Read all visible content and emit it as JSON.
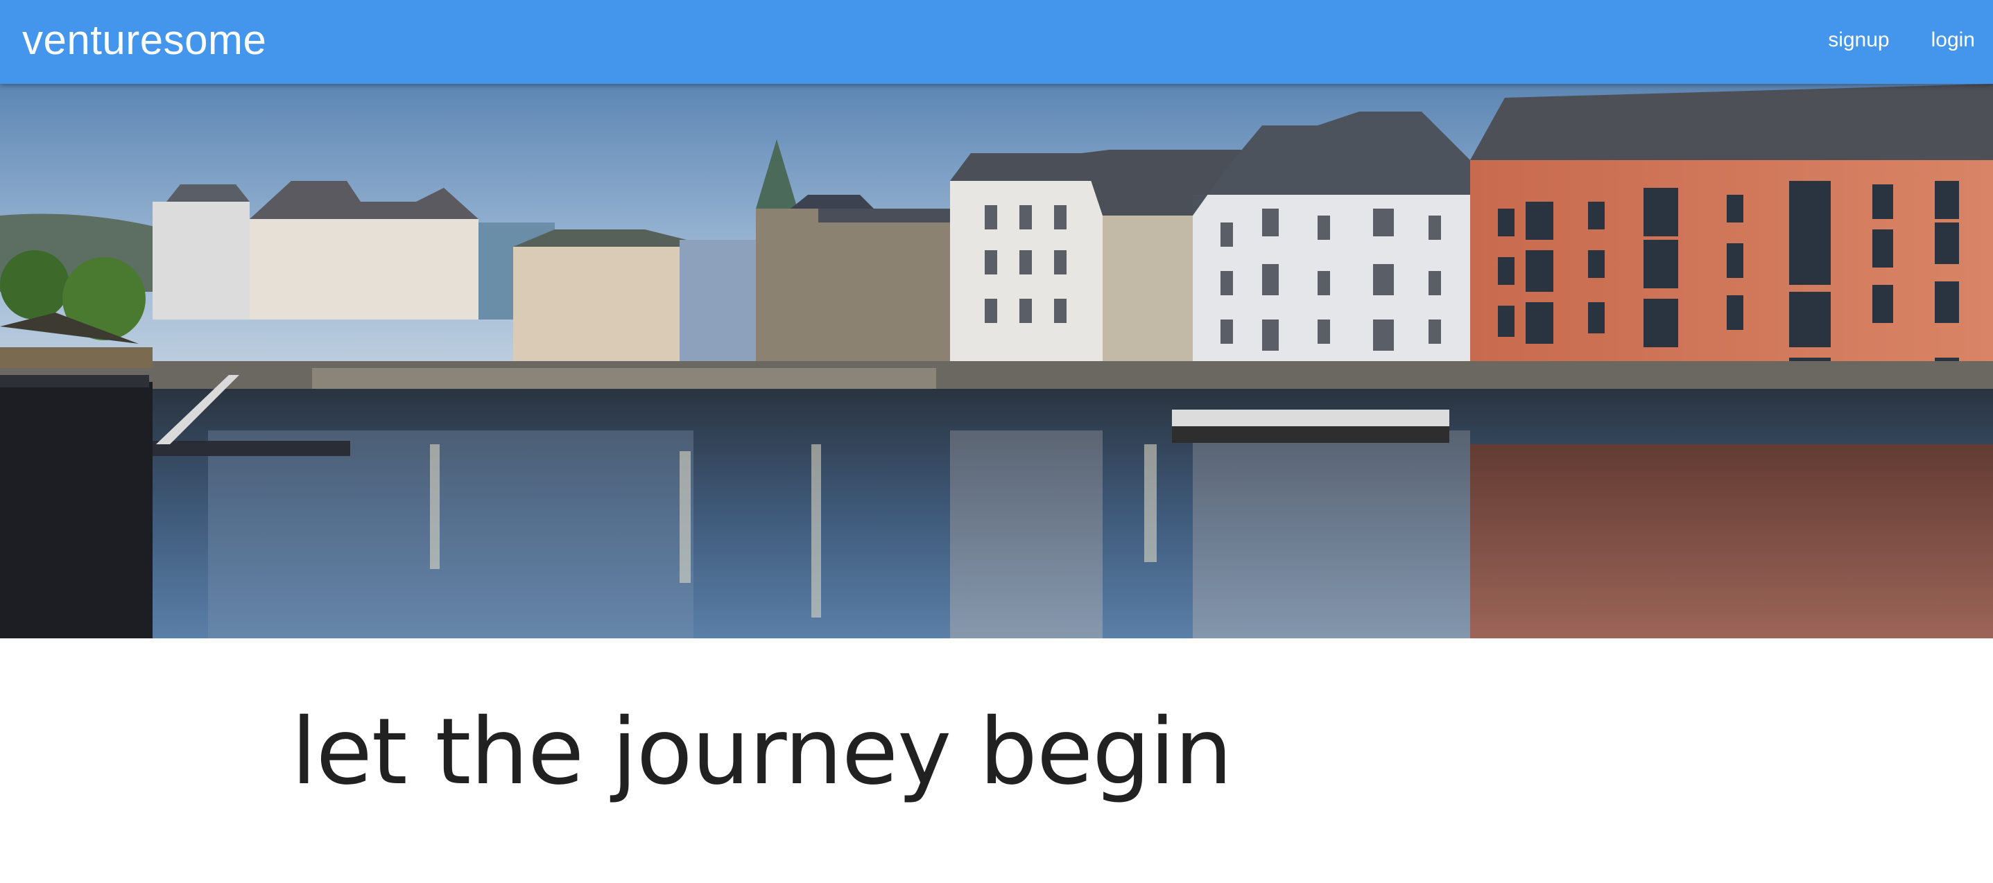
{
  "navbar": {
    "brand": "venturesome",
    "links": [
      {
        "label": "signup"
      },
      {
        "label": "login"
      }
    ],
    "background_color": "#4496ec"
  },
  "hero": {
    "image_subject": "harbor waterfront with colorful buildings reflected in water"
  },
  "main": {
    "tagline": "let the journey begin"
  }
}
